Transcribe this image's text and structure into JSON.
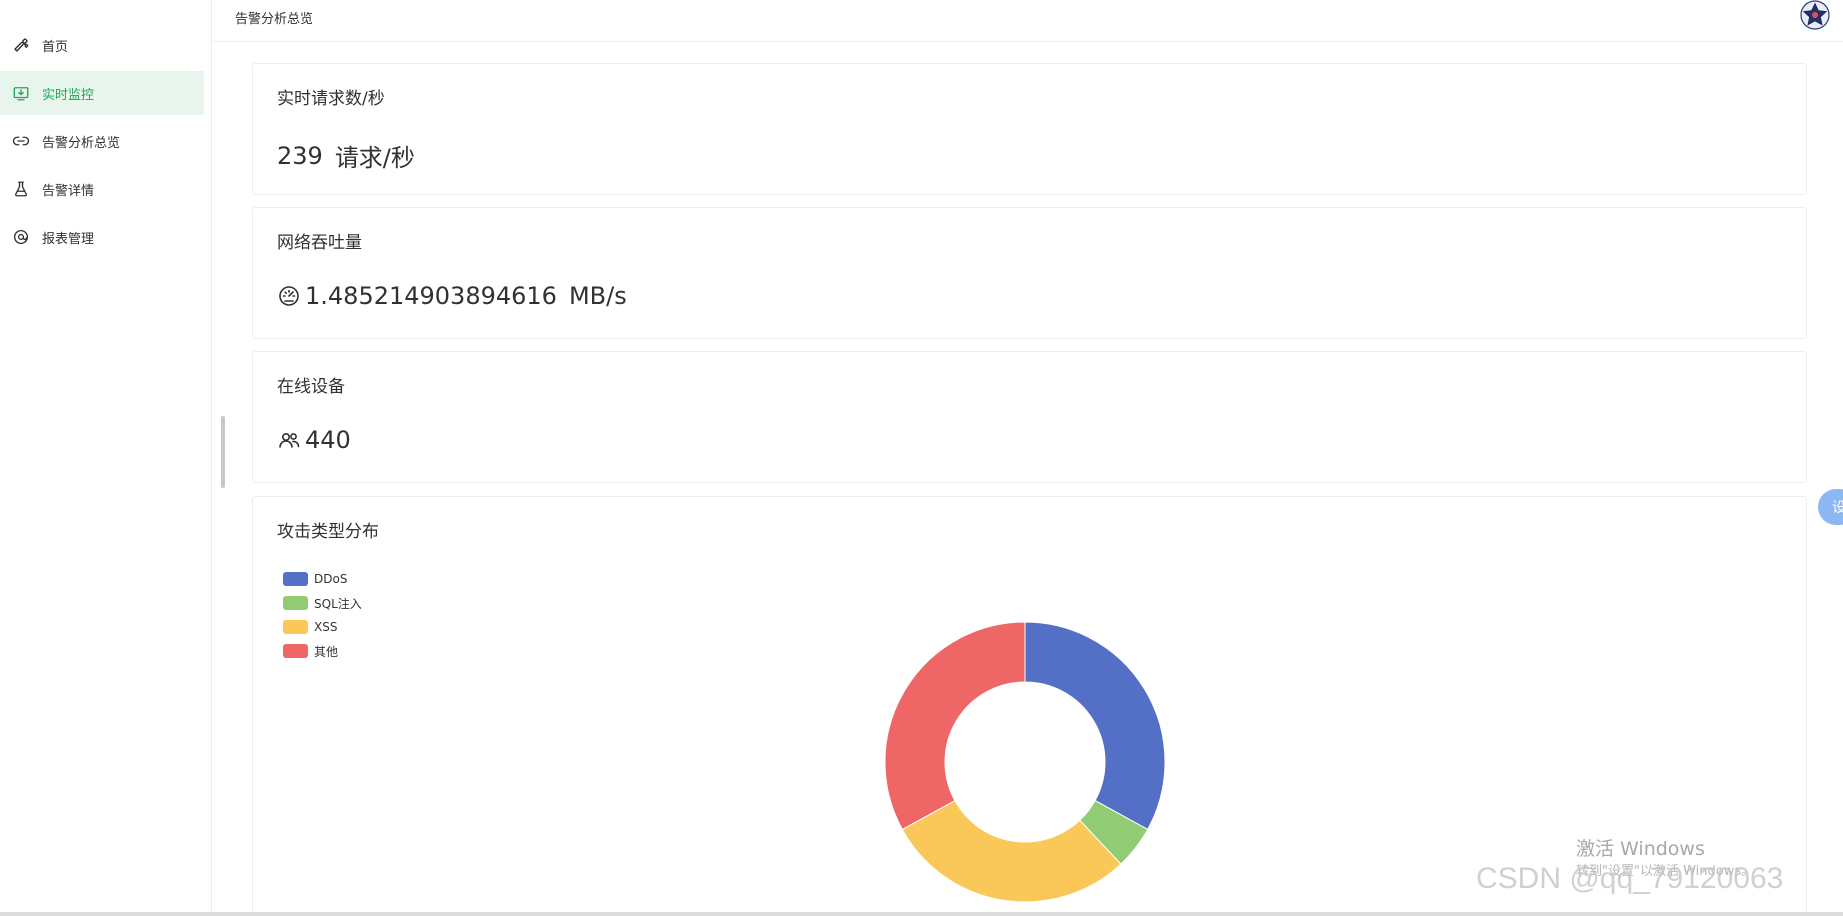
{
  "sidebar": {
    "items": [
      {
        "label": "首页",
        "icon": "wrench-icon",
        "active": false
      },
      {
        "label": "实时监控",
        "icon": "monitor-download-icon",
        "active": true
      },
      {
        "label": "告警分析总览",
        "icon": "link-icon",
        "active": false
      },
      {
        "label": "告警详情",
        "icon": "flask-icon",
        "active": false
      },
      {
        "label": "报表管理",
        "icon": "at-circle-icon",
        "active": false
      }
    ]
  },
  "header": {
    "breadcrumb": "告警分析总览",
    "avatar_icon": "star-badge-icon"
  },
  "cards": {
    "rps": {
      "title": "实时请求数/秒",
      "value": "239",
      "unit": "请求/秒"
    },
    "throughput": {
      "title": "网络吞吐量",
      "value": "1.485214903894616",
      "unit": "MB/s",
      "icon": "speedometer-icon"
    },
    "devices": {
      "title": "在线设备",
      "value": "440",
      "icon": "users-icon"
    },
    "attack": {
      "title": "攻击类型分布"
    }
  },
  "chart_data": {
    "type": "pie",
    "variant": "donut",
    "legend_position": "top-left",
    "series": [
      {
        "name": "DDoS",
        "value": 33,
        "color": "#5470c6"
      },
      {
        "name": "SQL注入",
        "value": 5,
        "color": "#91cc75"
      },
      {
        "name": "XSS",
        "value": 29,
        "color": "#fac858"
      },
      {
        "name": "其他",
        "value": 33,
        "color": "#ee6666"
      }
    ]
  },
  "float_button": {
    "label": "设",
    "color": "#8bb8f5"
  },
  "watermarks": {
    "activate_title": "激活 Windows",
    "activate_sub": "转到\"设置\"以激活 Windows。",
    "csdn": "CSDN @qq_79120063"
  },
  "colors": {
    "accent": "#1ea655",
    "active_bg": "#e8f5ec"
  }
}
